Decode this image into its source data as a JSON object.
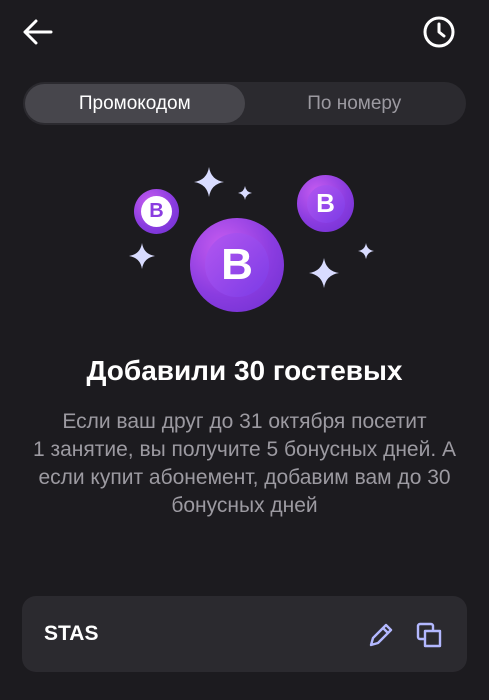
{
  "header": {
    "back_icon": "arrow-left-icon",
    "history_icon": "clock-icon"
  },
  "tabs": [
    {
      "label": "Промокодом",
      "active": true
    },
    {
      "label": "По номеру",
      "active": false
    }
  ],
  "illustration": {
    "badge_letter": "B",
    "accent_color": "#9b45e8"
  },
  "title": "Добавили 30 гостевых",
  "description": "Если ваш друг до 31 октября посетит\n1 занятие, вы получите 5 бонусных дней. А если купит абонемент, добавим вам до 30 бонусных дней",
  "promo": {
    "code": "STAS",
    "edit_icon": "pencil-icon",
    "copy_icon": "copy-icon"
  }
}
